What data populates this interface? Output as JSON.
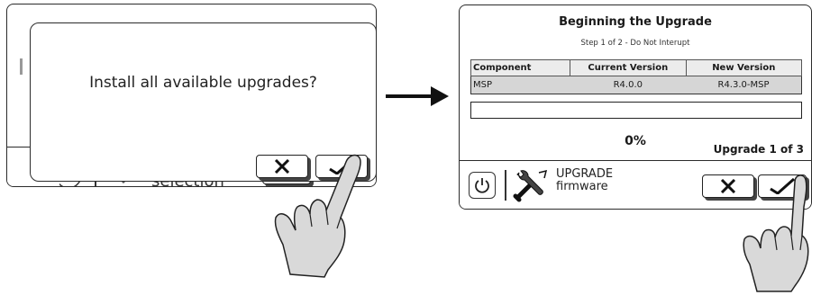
{
  "left_screen": {
    "dialog_message": "Install all available upgrades?",
    "background_label": "selection",
    "cancel_icon": "x-icon",
    "confirm_icon": "check-icon"
  },
  "right_screen": {
    "title": "Beginning the Upgrade",
    "step_text": "Step 1 of 2 - Do Not Interupt",
    "table": {
      "headers": [
        "Component",
        "Current Version",
        "New Version"
      ],
      "rows": [
        [
          "MSP",
          "R4.0.0",
          "R4.3.0-MSP"
        ]
      ]
    },
    "progress_percent": 0,
    "progress_label": "0%",
    "upgrade_count": "Upgrade 1 of 3",
    "footer": {
      "power_icon": "power-icon",
      "tool_icon": "wrench-screwdriver-icon",
      "mode_title": "UPGRADE",
      "mode_subtitle": "firmware",
      "cancel_icon": "x-icon",
      "confirm_icon": "check-icon"
    }
  },
  "colors": {
    "outline": "#2b2b2b",
    "table_header_bg": "#ececec",
    "table_row_bg": "#d6d6d6",
    "hand_fill": "#d9d9d9"
  }
}
